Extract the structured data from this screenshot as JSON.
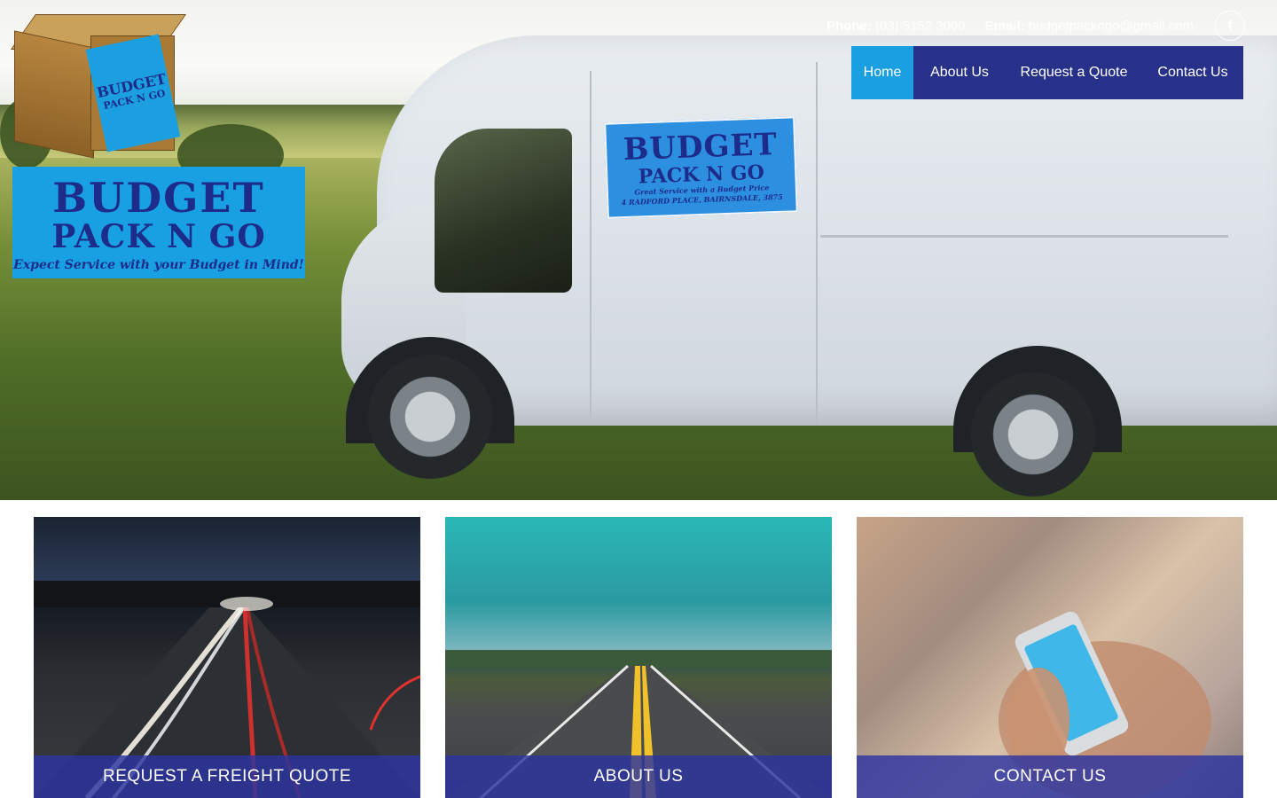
{
  "header": {
    "phone_label": "Phone:",
    "phone_value": "(03) 5152 3000",
    "email_label": "Email:",
    "email_value": "budgetpackngo@gmail.com",
    "facebook_glyph": "f"
  },
  "nav": {
    "items": [
      {
        "label": "Home",
        "active": true
      },
      {
        "label": "About Us"
      },
      {
        "label": "Request a Quote"
      },
      {
        "label": "Contact Us"
      }
    ]
  },
  "logo": {
    "box_line1": "BUDGET",
    "box_line2": "PACK N GO",
    "banner_line1": "BUDGET",
    "banner_line2": "PACK N GO",
    "tagline": "Expect Service with your Budget in Mind!"
  },
  "van_sign": {
    "line1": "BUDGET",
    "line2": "PACK N GO",
    "line3": "Great Service with a Budget Price",
    "line4": "4 RADFORD PLACE, BAIRNSDALE, 3875"
  },
  "cards": [
    {
      "caption": "REQUEST A FREIGHT QUOTE"
    },
    {
      "caption": "ABOUT US"
    },
    {
      "caption": "CONTACT US"
    }
  ],
  "colors": {
    "nav_bg": "#28318a",
    "nav_active": "#1aa0e0",
    "caption_bg": "#2c35a0",
    "logo_blue": "#18a0e2",
    "logo_text": "#1d2b8a"
  }
}
